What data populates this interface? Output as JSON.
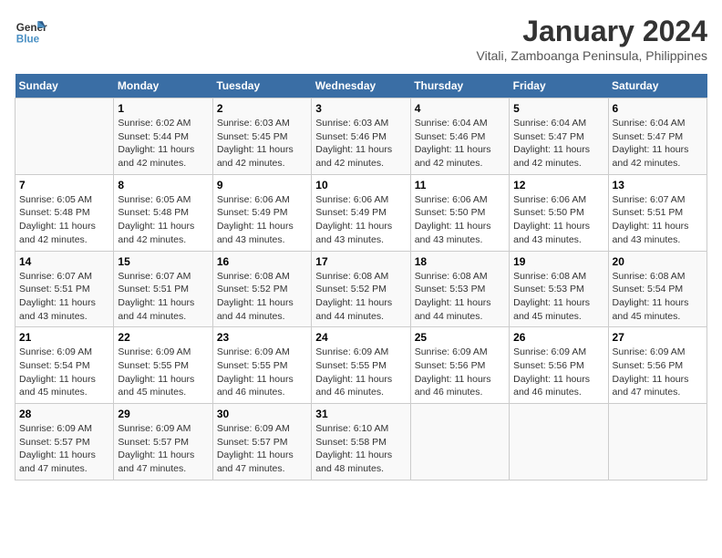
{
  "logo": {
    "line1": "General",
    "line2": "Blue"
  },
  "title": "January 2024",
  "subtitle": "Vitali, Zamboanga Peninsula, Philippines",
  "days_of_week": [
    "Sunday",
    "Monday",
    "Tuesday",
    "Wednesday",
    "Thursday",
    "Friday",
    "Saturday"
  ],
  "weeks": [
    [
      {
        "day": "",
        "info": ""
      },
      {
        "day": "1",
        "info": "Sunrise: 6:02 AM\nSunset: 5:44 PM\nDaylight: 11 hours\nand 42 minutes."
      },
      {
        "day": "2",
        "info": "Sunrise: 6:03 AM\nSunset: 5:45 PM\nDaylight: 11 hours\nand 42 minutes."
      },
      {
        "day": "3",
        "info": "Sunrise: 6:03 AM\nSunset: 5:46 PM\nDaylight: 11 hours\nand 42 minutes."
      },
      {
        "day": "4",
        "info": "Sunrise: 6:04 AM\nSunset: 5:46 PM\nDaylight: 11 hours\nand 42 minutes."
      },
      {
        "day": "5",
        "info": "Sunrise: 6:04 AM\nSunset: 5:47 PM\nDaylight: 11 hours\nand 42 minutes."
      },
      {
        "day": "6",
        "info": "Sunrise: 6:04 AM\nSunset: 5:47 PM\nDaylight: 11 hours\nand 42 minutes."
      }
    ],
    [
      {
        "day": "7",
        "info": "Sunrise: 6:05 AM\nSunset: 5:48 PM\nDaylight: 11 hours\nand 42 minutes."
      },
      {
        "day": "8",
        "info": "Sunrise: 6:05 AM\nSunset: 5:48 PM\nDaylight: 11 hours\nand 42 minutes."
      },
      {
        "day": "9",
        "info": "Sunrise: 6:06 AM\nSunset: 5:49 PM\nDaylight: 11 hours\nand 43 minutes."
      },
      {
        "day": "10",
        "info": "Sunrise: 6:06 AM\nSunset: 5:49 PM\nDaylight: 11 hours\nand 43 minutes."
      },
      {
        "day": "11",
        "info": "Sunrise: 6:06 AM\nSunset: 5:50 PM\nDaylight: 11 hours\nand 43 minutes."
      },
      {
        "day": "12",
        "info": "Sunrise: 6:06 AM\nSunset: 5:50 PM\nDaylight: 11 hours\nand 43 minutes."
      },
      {
        "day": "13",
        "info": "Sunrise: 6:07 AM\nSunset: 5:51 PM\nDaylight: 11 hours\nand 43 minutes."
      }
    ],
    [
      {
        "day": "14",
        "info": "Sunrise: 6:07 AM\nSunset: 5:51 PM\nDaylight: 11 hours\nand 43 minutes."
      },
      {
        "day": "15",
        "info": "Sunrise: 6:07 AM\nSunset: 5:51 PM\nDaylight: 11 hours\nand 44 minutes."
      },
      {
        "day": "16",
        "info": "Sunrise: 6:08 AM\nSunset: 5:52 PM\nDaylight: 11 hours\nand 44 minutes."
      },
      {
        "day": "17",
        "info": "Sunrise: 6:08 AM\nSunset: 5:52 PM\nDaylight: 11 hours\nand 44 minutes."
      },
      {
        "day": "18",
        "info": "Sunrise: 6:08 AM\nSunset: 5:53 PM\nDaylight: 11 hours\nand 44 minutes."
      },
      {
        "day": "19",
        "info": "Sunrise: 6:08 AM\nSunset: 5:53 PM\nDaylight: 11 hours\nand 45 minutes."
      },
      {
        "day": "20",
        "info": "Sunrise: 6:08 AM\nSunset: 5:54 PM\nDaylight: 11 hours\nand 45 minutes."
      }
    ],
    [
      {
        "day": "21",
        "info": "Sunrise: 6:09 AM\nSunset: 5:54 PM\nDaylight: 11 hours\nand 45 minutes."
      },
      {
        "day": "22",
        "info": "Sunrise: 6:09 AM\nSunset: 5:55 PM\nDaylight: 11 hours\nand 45 minutes."
      },
      {
        "day": "23",
        "info": "Sunrise: 6:09 AM\nSunset: 5:55 PM\nDaylight: 11 hours\nand 46 minutes."
      },
      {
        "day": "24",
        "info": "Sunrise: 6:09 AM\nSunset: 5:55 PM\nDaylight: 11 hours\nand 46 minutes."
      },
      {
        "day": "25",
        "info": "Sunrise: 6:09 AM\nSunset: 5:56 PM\nDaylight: 11 hours\nand 46 minutes."
      },
      {
        "day": "26",
        "info": "Sunrise: 6:09 AM\nSunset: 5:56 PM\nDaylight: 11 hours\nand 46 minutes."
      },
      {
        "day": "27",
        "info": "Sunrise: 6:09 AM\nSunset: 5:56 PM\nDaylight: 11 hours\nand 47 minutes."
      }
    ],
    [
      {
        "day": "28",
        "info": "Sunrise: 6:09 AM\nSunset: 5:57 PM\nDaylight: 11 hours\nand 47 minutes."
      },
      {
        "day": "29",
        "info": "Sunrise: 6:09 AM\nSunset: 5:57 PM\nDaylight: 11 hours\nand 47 minutes."
      },
      {
        "day": "30",
        "info": "Sunrise: 6:09 AM\nSunset: 5:57 PM\nDaylight: 11 hours\nand 47 minutes."
      },
      {
        "day": "31",
        "info": "Sunrise: 6:10 AM\nSunset: 5:58 PM\nDaylight: 11 hours\nand 48 minutes."
      },
      {
        "day": "",
        "info": ""
      },
      {
        "day": "",
        "info": ""
      },
      {
        "day": "",
        "info": ""
      }
    ]
  ]
}
